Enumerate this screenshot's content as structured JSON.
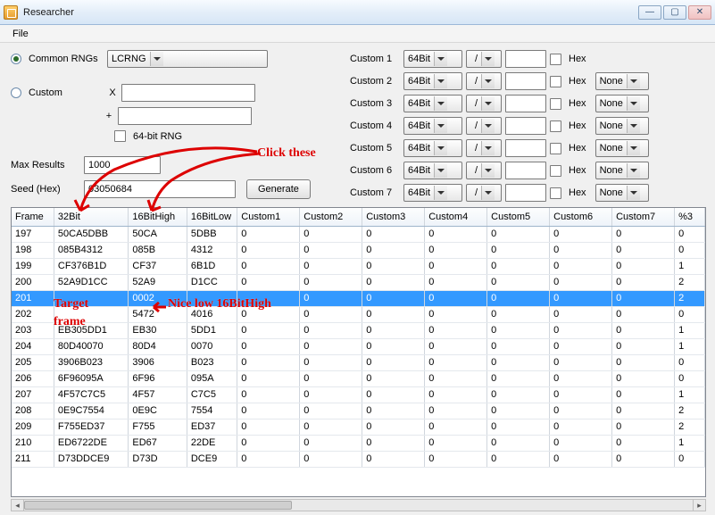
{
  "window": {
    "title": "Researcher"
  },
  "menu": {
    "file": "File"
  },
  "rng": {
    "common_label": "Common RNGs",
    "common_value": "LCRNG",
    "custom_label": "Custom",
    "x_label": "X",
    "plus_label": "+",
    "bit64_label": "64-bit RNG"
  },
  "inputs": {
    "max_results_label": "Max Results",
    "max_results_value": "1000",
    "seed_label": "Seed (Hex)",
    "seed_value": "03050684",
    "generate_label": "Generate"
  },
  "custom_rows": [
    {
      "label": "Custom 1",
      "type": "64Bit",
      "op": "/",
      "hex": "Hex",
      "none": null
    },
    {
      "label": "Custom 2",
      "type": "64Bit",
      "op": "/",
      "hex": "Hex",
      "none": "None"
    },
    {
      "label": "Custom 3",
      "type": "64Bit",
      "op": "/",
      "hex": "Hex",
      "none": "None"
    },
    {
      "label": "Custom 4",
      "type": "64Bit",
      "op": "/",
      "hex": "Hex",
      "none": "None"
    },
    {
      "label": "Custom 5",
      "type": "64Bit",
      "op": "/",
      "hex": "Hex",
      "none": "None"
    },
    {
      "label": "Custom 6",
      "type": "64Bit",
      "op": "/",
      "hex": "Hex",
      "none": "None"
    },
    {
      "label": "Custom 7",
      "type": "64Bit",
      "op": "/",
      "hex": "Hex",
      "none": "None"
    }
  ],
  "columns": [
    "Frame",
    "32Bit",
    "16BitHigh",
    "16BitLow",
    "Custom1",
    "Custom2",
    "Custom3",
    "Custom4",
    "Custom5",
    "Custom6",
    "Custom7",
    "%3"
  ],
  "rows": [
    {
      "frame": "197",
      "b32": "50CA5DBB",
      "h": "50CA",
      "l": "5DBB",
      "c": [
        "0",
        "0",
        "0",
        "0",
        "0",
        "0",
        "0"
      ],
      "p": "0"
    },
    {
      "frame": "198",
      "b32": "085B4312",
      "h": "085B",
      "l": "4312",
      "c": [
        "0",
        "0",
        "0",
        "0",
        "0",
        "0",
        "0"
      ],
      "p": "0"
    },
    {
      "frame": "199",
      "b32": "CF376B1D",
      "h": "CF37",
      "l": "6B1D",
      "c": [
        "0",
        "0",
        "0",
        "0",
        "0",
        "0",
        "0"
      ],
      "p": "1"
    },
    {
      "frame": "200",
      "b32": "52A9D1CC",
      "h": "52A9",
      "l": "D1CC",
      "c": [
        "0",
        "0",
        "0",
        "0",
        "0",
        "0",
        "0"
      ],
      "p": "2"
    },
    {
      "frame": "201",
      "b32": "",
      "h": "0002",
      "l": "",
      "c": [
        "",
        "0",
        "0",
        "0",
        "0",
        "0",
        "0"
      ],
      "p": "2",
      "sel": true
    },
    {
      "frame": "202",
      "b32": "",
      "h": "5472",
      "l": "4016",
      "c": [
        "0",
        "0",
        "0",
        "0",
        "0",
        "0",
        "0"
      ],
      "p": "0"
    },
    {
      "frame": "203",
      "b32": "EB305DD1",
      "h": "EB30",
      "l": "5DD1",
      "c": [
        "0",
        "0",
        "0",
        "0",
        "0",
        "0",
        "0"
      ],
      "p": "1"
    },
    {
      "frame": "204",
      "b32": "80D40070",
      "h": "80D4",
      "l": "0070",
      "c": [
        "0",
        "0",
        "0",
        "0",
        "0",
        "0",
        "0"
      ],
      "p": "1"
    },
    {
      "frame": "205",
      "b32": "3906B023",
      "h": "3906",
      "l": "B023",
      "c": [
        "0",
        "0",
        "0",
        "0",
        "0",
        "0",
        "0"
      ],
      "p": "0"
    },
    {
      "frame": "206",
      "b32": "6F96095A",
      "h": "6F96",
      "l": "095A",
      "c": [
        "0",
        "0",
        "0",
        "0",
        "0",
        "0",
        "0"
      ],
      "p": "0"
    },
    {
      "frame": "207",
      "b32": "4F57C7C5",
      "h": "4F57",
      "l": "C7C5",
      "c": [
        "0",
        "0",
        "0",
        "0",
        "0",
        "0",
        "0"
      ],
      "p": "1"
    },
    {
      "frame": "208",
      "b32": "0E9C7554",
      "h": "0E9C",
      "l": "7554",
      "c": [
        "0",
        "0",
        "0",
        "0",
        "0",
        "0",
        "0"
      ],
      "p": "2"
    },
    {
      "frame": "209",
      "b32": "F755ED37",
      "h": "F755",
      "l": "ED37",
      "c": [
        "0",
        "0",
        "0",
        "0",
        "0",
        "0",
        "0"
      ],
      "p": "2"
    },
    {
      "frame": "210",
      "b32": "ED6722DE",
      "h": "ED67",
      "l": "22DE",
      "c": [
        "0",
        "0",
        "0",
        "0",
        "0",
        "0",
        "0"
      ],
      "p": "1"
    },
    {
      "frame": "211",
      "b32": "D73DDCE9",
      "h": "D73D",
      "l": "DCE9",
      "c": [
        "0",
        "0",
        "0",
        "0",
        "0",
        "0",
        "0"
      ],
      "p": "0"
    }
  ],
  "annotations": {
    "click_these": "Click these",
    "target": "Target",
    "frame": "frame",
    "nice": "Nice low 16BitHigh"
  }
}
